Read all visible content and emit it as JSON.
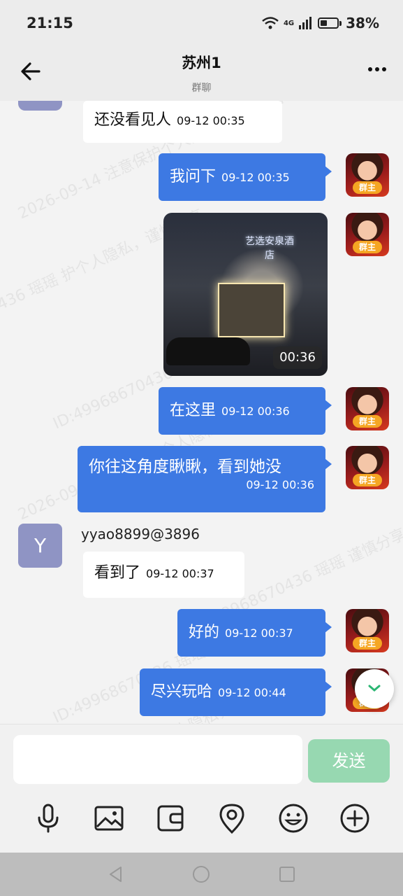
{
  "status_bar": {
    "time": "21:15",
    "battery": "38%",
    "network": "4G"
  },
  "header": {
    "title": "苏州1",
    "subtitle": "群聊"
  },
  "messages": [
    {
      "dir": "in",
      "text": "还没看见人",
      "time": "09-12 00:35"
    },
    {
      "dir": "out",
      "text": "我问下",
      "time": "09-12 00:35",
      "badge": "群主"
    },
    {
      "dir": "out",
      "type": "video",
      "duration": "00:36",
      "badge": "群主",
      "video_sign": "艺选安泉酒店"
    },
    {
      "dir": "out",
      "text": "在这里",
      "time": "09-12 00:36",
      "badge": "群主"
    },
    {
      "dir": "out",
      "text": "你往这角度瞅瞅，看到她没",
      "time": "09-12 00:36",
      "badge": "群主"
    },
    {
      "dir": "in",
      "sender": "yyao8899@3896",
      "avatar_letter": "Y",
      "text": "看到了",
      "time": "09-12 00:37"
    },
    {
      "dir": "out",
      "text": "好的",
      "time": "09-12 00:37",
      "badge": "群主"
    },
    {
      "dir": "out",
      "text": "尽兴玩哈",
      "time": "09-12 00:44",
      "badge": "群主"
    }
  ],
  "input": {
    "placeholder": "",
    "send_label": "发送"
  },
  "toolbar": [
    "mic-icon",
    "image-icon",
    "wallet-icon",
    "location-icon",
    "emoji-icon",
    "plus-icon"
  ],
  "watermark": {
    "line1": "2026-09-14 注意保护个人隐私，谨慎分享",
    "line2": "ID:49968670436 瑶瑶",
    "line3": "436 瑶瑶 护个人隐私，谨慎分享",
    "line4": "ID:49968670436 瑶瑶 谨慎分享"
  },
  "colors": {
    "out_bubble": "#3d79e3",
    "send_button": "#97d8b1",
    "badge": "#f5a623",
    "avatar_y": "#8f94c4"
  }
}
